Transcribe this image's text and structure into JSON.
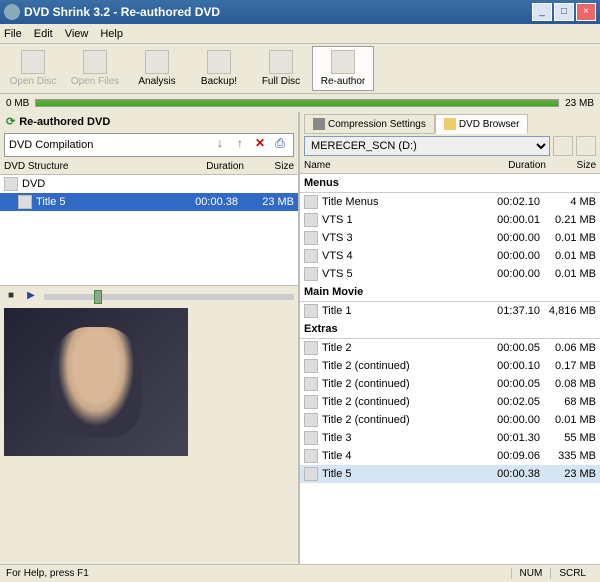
{
  "window": {
    "title": "DVD Shrink 3.2 - Re-authored DVD"
  },
  "menu": {
    "file": "File",
    "edit": "Edit",
    "view": "View",
    "help": "Help"
  },
  "toolbar": {
    "opendisc": "Open Disc",
    "openfiles": "Open Files",
    "analysis": "Analysis",
    "backup": "Backup!",
    "fulldisc": "Full Disc",
    "reauthor": "Re-author"
  },
  "sizebar": {
    "left": "0 MB",
    "right": "23 MB"
  },
  "left": {
    "title": "Re-authored DVD",
    "comp_value": "DVD Compilation",
    "hdr": {
      "structure": "DVD Structure",
      "duration": "Duration",
      "size": "Size"
    },
    "dvd_root": "DVD",
    "title5": {
      "name": "Title 5",
      "duration": "00:00.38",
      "size": "23 MB"
    }
  },
  "right": {
    "tabs": {
      "comp": "Compression Settings",
      "browser": "DVD Browser"
    },
    "drive": "MERECER_SCN (D:)",
    "hdr": {
      "name": "Name",
      "duration": "Duration",
      "size": "Size"
    },
    "sections": {
      "menus": "Menus",
      "main": "Main Movie",
      "extras": "Extras"
    },
    "menus": [
      {
        "name": "Title Menus",
        "duration": "00:02.10",
        "size": "4 MB"
      },
      {
        "name": "VTS 1",
        "duration": "00:00.01",
        "size": "0.21 MB"
      },
      {
        "name": "VTS 3",
        "duration": "00:00.00",
        "size": "0.01 MB"
      },
      {
        "name": "VTS 4",
        "duration": "00:00.00",
        "size": "0.01 MB"
      },
      {
        "name": "VTS 5",
        "duration": "00:00.00",
        "size": "0.01 MB"
      }
    ],
    "main_movie": [
      {
        "name": "Title 1",
        "duration": "01:37.10",
        "size": "4,816 MB"
      }
    ],
    "extras": [
      {
        "name": "Title 2",
        "duration": "00:00.05",
        "size": "0.06 MB"
      },
      {
        "name": "Title 2 (continued)",
        "duration": "00:00.10",
        "size": "0.17 MB"
      },
      {
        "name": "Title 2 (continued)",
        "duration": "00:00.05",
        "size": "0.08 MB"
      },
      {
        "name": "Title 2 (continued)",
        "duration": "00:02.05",
        "size": "68 MB"
      },
      {
        "name": "Title 2 (continued)",
        "duration": "00:00.00",
        "size": "0.01 MB"
      },
      {
        "name": "Title 3",
        "duration": "00:01.30",
        "size": "55 MB"
      },
      {
        "name": "Title 4",
        "duration": "00:09.06",
        "size": "335 MB"
      },
      {
        "name": "Title 5",
        "duration": "00:00.38",
        "size": "23 MB"
      }
    ]
  },
  "status": {
    "help": "For Help, press F1",
    "num": "NUM",
    "scrl": "SCRL"
  }
}
